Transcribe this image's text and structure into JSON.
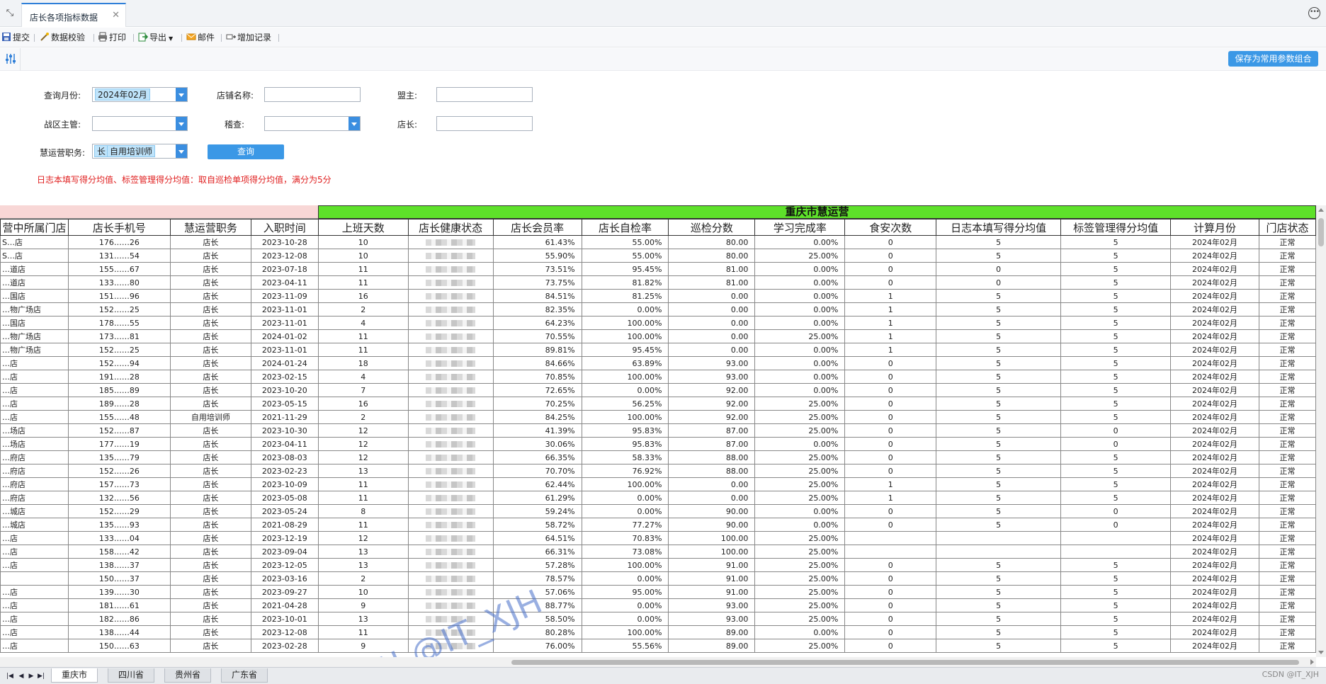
{
  "window": {
    "tab_title": "店长各项指标数据",
    "close_glyph": "✕"
  },
  "toolbar": {
    "submit": "提交",
    "validate": "数据校验",
    "print": "打印",
    "export": "导出",
    "mail": "邮件",
    "add_record": "增加记录"
  },
  "params": {
    "save_combo": "保存为常用参数组合",
    "month_label": "查询月份:",
    "month_value": "2024年02月",
    "store_label": "店铺名称:",
    "store_value": "",
    "franchisee_label": "盟主:",
    "franchisee_value": "",
    "district_label": "战区主管:",
    "district_value": "",
    "audit_label": "稽查:",
    "audit_value": "",
    "manager_label": "店长:",
    "manager_value": "",
    "role_label": "慧运营职务:",
    "role_tag1": "长",
    "role_tag2": "自用培训师",
    "query_button": "查询",
    "note": "日志本填写得分均值、标签管理得分均值：取自巡检单项得分均值，满分为5分"
  },
  "report": {
    "group_title": "重庆市慧运营",
    "columns": [
      "营中所属门店",
      "店长手机号",
      "慧运营职务",
      "入职时间",
      "上班天数",
      "店长健康状态",
      "店长会员率",
      "店长自检率",
      "巡检分数",
      "学习完成率",
      "食安次数",
      "日志本填写得分均值",
      "标签管理得分均值",
      "计算月份",
      "门店状态"
    ],
    "rows": [
      {
        "store": "S…店",
        "phone": "176……26",
        "role": "店长",
        "join": "2023-10-28",
        "days": "10",
        "member": "61.43%",
        "self": "55.00%",
        "inspect": "80.00",
        "learn": "0.00%",
        "food": "0",
        "log": "5",
        "tag": "5",
        "month": "2024年02月",
        "status": "正常"
      },
      {
        "store": "S…店",
        "phone": "131……54",
        "role": "店长",
        "join": "2023-12-08",
        "days": "10",
        "member": "55.90%",
        "self": "55.00%",
        "inspect": "80.00",
        "learn": "25.00%",
        "food": "0",
        "log": "5",
        "tag": "5",
        "month": "2024年02月",
        "status": "正常"
      },
      {
        "store": "…道店",
        "phone": "155……67",
        "role": "店长",
        "join": "2023-07-18",
        "days": "11",
        "member": "73.51%",
        "self": "95.45%",
        "inspect": "81.00",
        "learn": "0.00%",
        "food": "0",
        "log": "0",
        "tag": "5",
        "month": "2024年02月",
        "status": "正常"
      },
      {
        "store": "…道店",
        "phone": "133……80",
        "role": "店长",
        "join": "2023-04-11",
        "days": "11",
        "member": "73.75%",
        "self": "81.82%",
        "inspect": "81.00",
        "learn": "0.00%",
        "food": "0",
        "log": "0",
        "tag": "5",
        "month": "2024年02月",
        "status": "正常"
      },
      {
        "store": "…国店",
        "phone": "151……96",
        "role": "店长",
        "join": "2023-11-09",
        "days": "16",
        "member": "84.51%",
        "self": "81.25%",
        "inspect": "0.00",
        "learn": "0.00%",
        "food": "1",
        "log": "5",
        "tag": "5",
        "month": "2024年02月",
        "status": "正常"
      },
      {
        "store": "…物广场店",
        "phone": "152……25",
        "role": "店长",
        "join": "2023-11-01",
        "days": "2",
        "member": "82.35%",
        "self": "0.00%",
        "inspect": "0.00",
        "learn": "0.00%",
        "food": "1",
        "log": "5",
        "tag": "5",
        "month": "2024年02月",
        "status": "正常"
      },
      {
        "store": "…国店",
        "phone": "178……55",
        "role": "店长",
        "join": "2023-11-01",
        "days": "4",
        "member": "64.23%",
        "self": "100.00%",
        "inspect": "0.00",
        "learn": "0.00%",
        "food": "1",
        "log": "5",
        "tag": "5",
        "month": "2024年02月",
        "status": "正常"
      },
      {
        "store": "…物广场店",
        "phone": "173……81",
        "role": "店长",
        "join": "2024-01-02",
        "days": "11",
        "member": "70.55%",
        "self": "100.00%",
        "inspect": "0.00",
        "learn": "25.00%",
        "food": "1",
        "log": "5",
        "tag": "5",
        "month": "2024年02月",
        "status": "正常"
      },
      {
        "store": "…物广场店",
        "phone": "152……25",
        "role": "店长",
        "join": "2023-11-01",
        "days": "11",
        "member": "89.81%",
        "self": "95.45%",
        "inspect": "0.00",
        "learn": "0.00%",
        "food": "1",
        "log": "5",
        "tag": "5",
        "month": "2024年02月",
        "status": "正常"
      },
      {
        "store": "…店",
        "phone": "152……94",
        "role": "店长",
        "join": "2024-01-24",
        "days": "18",
        "member": "84.66%",
        "self": "63.89%",
        "inspect": "93.00",
        "learn": "0.00%",
        "food": "0",
        "log": "5",
        "tag": "5",
        "month": "2024年02月",
        "status": "正常"
      },
      {
        "store": "…店",
        "phone": "191……28",
        "role": "店长",
        "join": "2023-02-15",
        "days": "4",
        "member": "70.85%",
        "self": "100.00%",
        "inspect": "93.00",
        "learn": "0.00%",
        "food": "0",
        "log": "5",
        "tag": "5",
        "month": "2024年02月",
        "status": "正常"
      },
      {
        "store": "…店",
        "phone": "185……89",
        "role": "店长",
        "join": "2023-10-20",
        "days": "7",
        "member": "72.65%",
        "self": "0.00%",
        "inspect": "92.00",
        "learn": "0.00%",
        "food": "0",
        "log": "5",
        "tag": "5",
        "month": "2024年02月",
        "status": "正常"
      },
      {
        "store": "…店",
        "phone": "189……28",
        "role": "店长",
        "join": "2023-05-15",
        "days": "16",
        "member": "70.25%",
        "self": "56.25%",
        "inspect": "92.00",
        "learn": "25.00%",
        "food": "0",
        "log": "5",
        "tag": "5",
        "month": "2024年02月",
        "status": "正常"
      },
      {
        "store": "…店",
        "phone": "155……48",
        "role": "自用培训师",
        "join": "2021-11-29",
        "days": "2",
        "member": "84.25%",
        "self": "100.00%",
        "inspect": "92.00",
        "learn": "25.00%",
        "food": "0",
        "log": "5",
        "tag": "5",
        "month": "2024年02月",
        "status": "正常"
      },
      {
        "store": "…场店",
        "phone": "152……87",
        "role": "店长",
        "join": "2023-10-30",
        "days": "12",
        "member": "41.39%",
        "self": "95.83%",
        "inspect": "87.00",
        "learn": "25.00%",
        "food": "0",
        "log": "5",
        "tag": "0",
        "month": "2024年02月",
        "status": "正常"
      },
      {
        "store": "…场店",
        "phone": "177……19",
        "role": "店长",
        "join": "2023-04-11",
        "days": "12",
        "member": "30.06%",
        "self": "95.83%",
        "inspect": "87.00",
        "learn": "0.00%",
        "food": "0",
        "log": "5",
        "tag": "0",
        "month": "2024年02月",
        "status": "正常"
      },
      {
        "store": "…府店",
        "phone": "135……79",
        "role": "店长",
        "join": "2023-08-03",
        "days": "12",
        "member": "66.35%",
        "self": "58.33%",
        "inspect": "88.00",
        "learn": "25.00%",
        "food": "0",
        "log": "5",
        "tag": "5",
        "month": "2024年02月",
        "status": "正常"
      },
      {
        "store": "…府店",
        "phone": "152……26",
        "role": "店长",
        "join": "2023-02-23",
        "days": "13",
        "member": "70.70%",
        "self": "76.92%",
        "inspect": "88.00",
        "learn": "25.00%",
        "food": "0",
        "log": "5",
        "tag": "5",
        "month": "2024年02月",
        "status": "正常"
      },
      {
        "store": "…府店",
        "phone": "157……73",
        "role": "店长",
        "join": "2023-10-09",
        "days": "11",
        "member": "62.44%",
        "self": "100.00%",
        "inspect": "0.00",
        "learn": "25.00%",
        "food": "1",
        "log": "5",
        "tag": "5",
        "month": "2024年02月",
        "status": "正常"
      },
      {
        "store": "…府店",
        "phone": "132……56",
        "role": "店长",
        "join": "2023-05-08",
        "days": "11",
        "member": "61.29%",
        "self": "0.00%",
        "inspect": "0.00",
        "learn": "25.00%",
        "food": "1",
        "log": "5",
        "tag": "5",
        "month": "2024年02月",
        "status": "正常"
      },
      {
        "store": "…城店",
        "phone": "152……29",
        "role": "店长",
        "join": "2023-05-24",
        "days": "8",
        "member": "59.24%",
        "self": "0.00%",
        "inspect": "90.00",
        "learn": "0.00%",
        "food": "0",
        "log": "5",
        "tag": "0",
        "month": "2024年02月",
        "status": "正常"
      },
      {
        "store": "…城店",
        "phone": "135……93",
        "role": "店长",
        "join": "2021-08-29",
        "days": "11",
        "member": "58.72%",
        "self": "77.27%",
        "inspect": "90.00",
        "learn": "0.00%",
        "food": "0",
        "log": "5",
        "tag": "0",
        "month": "2024年02月",
        "status": "正常"
      },
      {
        "store": "…店",
        "phone": "133……04",
        "role": "店长",
        "join": "2023-12-19",
        "days": "12",
        "member": "64.51%",
        "self": "70.83%",
        "inspect": "100.00",
        "learn": "25.00%",
        "food": "",
        "log": "",
        "tag": "",
        "month": "2024年02月",
        "status": "正常"
      },
      {
        "store": "…店",
        "phone": "158……42",
        "role": "店长",
        "join": "2023-09-04",
        "days": "13",
        "member": "66.31%",
        "self": "73.08%",
        "inspect": "100.00",
        "learn": "25.00%",
        "food": "",
        "log": "",
        "tag": "",
        "month": "2024年02月",
        "status": "正常"
      },
      {
        "store": "…店",
        "phone": "138……37",
        "role": "店长",
        "join": "2023-12-05",
        "days": "13",
        "member": "57.28%",
        "self": "100.00%",
        "inspect": "91.00",
        "learn": "25.00%",
        "food": "0",
        "log": "5",
        "tag": "5",
        "month": "2024年02月",
        "status": "正常"
      },
      {
        "store": "",
        "phone": "150……37",
        "role": "店长",
        "join": "2023-03-16",
        "days": "2",
        "member": "78.57%",
        "self": "0.00%",
        "inspect": "91.00",
        "learn": "25.00%",
        "food": "0",
        "log": "5",
        "tag": "5",
        "month": "2024年02月",
        "status": "正常"
      },
      {
        "store": "…店",
        "phone": "139……30",
        "role": "店长",
        "join": "2023-09-27",
        "days": "10",
        "member": "57.06%",
        "self": "95.00%",
        "inspect": "91.00",
        "learn": "25.00%",
        "food": "0",
        "log": "5",
        "tag": "5",
        "month": "2024年02月",
        "status": "正常"
      },
      {
        "store": "…店",
        "phone": "181……61",
        "role": "店长",
        "join": "2021-04-28",
        "days": "9",
        "member": "88.77%",
        "self": "0.00%",
        "inspect": "93.00",
        "learn": "25.00%",
        "food": "0",
        "log": "5",
        "tag": "5",
        "month": "2024年02月",
        "status": "正常"
      },
      {
        "store": "…店",
        "phone": "182……86",
        "role": "店长",
        "join": "2023-10-01",
        "days": "13",
        "member": "58.50%",
        "self": "0.00%",
        "inspect": "93.00",
        "learn": "25.00%",
        "food": "0",
        "log": "5",
        "tag": "5",
        "month": "2024年02月",
        "status": "正常"
      },
      {
        "store": "…店",
        "phone": "138……44",
        "role": "店长",
        "join": "2023-12-08",
        "days": "11",
        "member": "80.28%",
        "self": "100.00%",
        "inspect": "89.00",
        "learn": "0.00%",
        "food": "0",
        "log": "5",
        "tag": "5",
        "month": "2024年02月",
        "status": "正常"
      },
      {
        "store": "…店",
        "phone": "150……63",
        "role": "店长",
        "join": "2023-02-28",
        "days": "9",
        "member": "76.00%",
        "self": "55.56%",
        "inspect": "89.00",
        "learn": "25.00%",
        "food": "0",
        "log": "5",
        "tag": "5",
        "month": "2024年02月",
        "status": "正常"
      }
    ]
  },
  "watermark": "CSDN @IT_XJH",
  "sheets": [
    "重庆市",
    "四川省",
    "贵州省",
    "广东省"
  ],
  "credit": "CSDN @IT_XJH",
  "colors": {
    "accent": "#3b98e6",
    "group_header": "#5ee12a",
    "group_left": "#f8d7d6",
    "note": "#e02020"
  }
}
